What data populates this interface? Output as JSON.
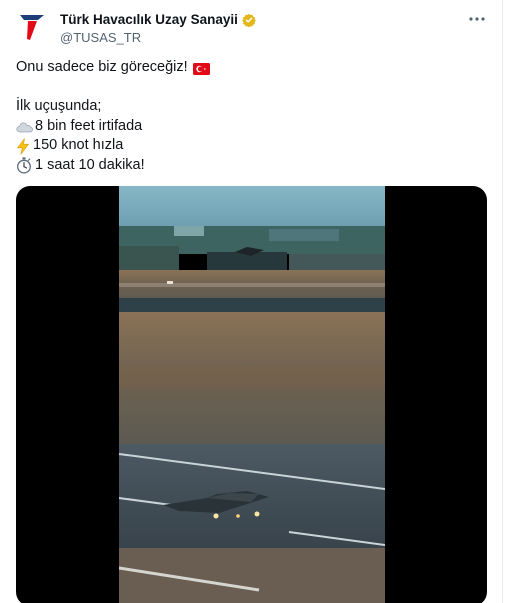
{
  "tweet": {
    "display_name": "Türk Havacılık Uzay Sanayii",
    "handle": "@TUSAS_TR",
    "lines": {
      "intro": "Onu sadece biz göreceğiz!",
      "first_flight": "İlk uçuşunda;",
      "altitude": "8 bin feet irtifada",
      "speed": "150 knot hızla",
      "duration": "1 saat 10 dakika!"
    },
    "icons": {
      "logo": "tusas-logo-icon",
      "verified": "gold-verified-badge-icon",
      "more": "more-options-icon",
      "flag": "turkey-flag-icon",
      "cloud": "cloud-icon",
      "bolt": "lightning-bolt-icon",
      "clock": "stopwatch-icon"
    }
  },
  "colors": {
    "text": "#0f1419",
    "secondary": "#536471",
    "verified_gold": "#e2b719",
    "logo_red": "#e30a17",
    "logo_navy": "#1c3f7a",
    "media_bg": "#000000"
  }
}
